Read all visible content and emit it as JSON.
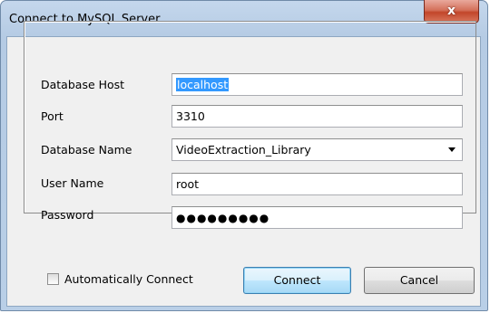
{
  "window": {
    "title": "Connect to MySQL Server",
    "close_label": "x"
  },
  "form": {
    "host": {
      "label": "Database Host",
      "value": "localhost"
    },
    "port": {
      "label": "Port",
      "value": "3310"
    },
    "database": {
      "label": "Database Name",
      "value": "VideoExtraction_Library"
    },
    "user": {
      "label": "User Name",
      "value": "root"
    },
    "password": {
      "label": "Password",
      "value": "●●●●●●●●●"
    }
  },
  "auto_connect": {
    "label": "Automatically Connect",
    "checked": false
  },
  "buttons": {
    "connect": "Connect",
    "cancel": "Cancel"
  },
  "colors": {
    "selection": "#3399ff",
    "close_button": "#c2462a",
    "titlebar": "#b5cbe4"
  }
}
